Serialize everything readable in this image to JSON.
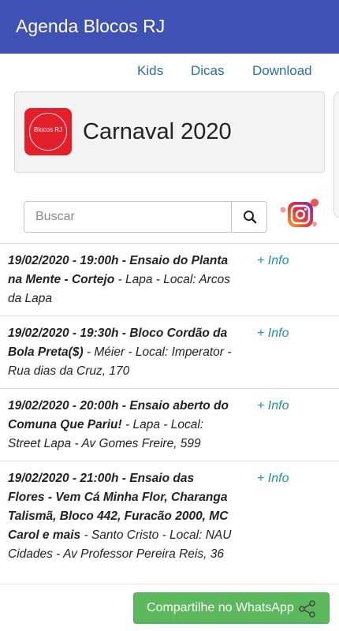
{
  "app": {
    "title": "Agenda Blocos RJ"
  },
  "nav": {
    "kids": "Kids",
    "dicas": "Dicas",
    "download": "Download"
  },
  "banner": {
    "logo_text": "Blocos RJ",
    "title": "Carnaval 2020",
    "logo_color": "#e21f2b"
  },
  "search": {
    "placeholder": "Buscar",
    "icon": "search-icon"
  },
  "instagram": {
    "icon": "instagram-icon"
  },
  "events": [
    {
      "title": "19/02/2020 - 19:00h - Ensaio do Planta na Mente - Cortejo",
      "details": " - Lapa - Local: Arcos da Lapa",
      "info": "+ Info"
    },
    {
      "title": "19/02/2020 - 19:30h - Bloco Cordão da Bola Preta($)",
      "details": " - Méier - Local: Imperator - Rua dias da Cruz, 170",
      "info": "+ Info"
    },
    {
      "title": "19/02/2020 - 20:00h - Ensaio aberto do Comuna Que Pariu!",
      "details": " - Lapa - Local: Street Lapa - Av Gomes Freire, 599",
      "info": "+ Info"
    },
    {
      "title": "19/02/2020 - 21:00h - Ensaio das Flores - Vem Cá Minha Flor, Charanga Talismã, Bloco 442, Furacão 2000, MC Carol e mais",
      "details": " - Santo Cristo - Local: NAU Cidades - Av Professor Pereira Reis, 36",
      "info": "+ Info"
    }
  ],
  "footer": {
    "share_label": "Compartilhe no WhatsApp",
    "share_icon": "share-icon"
  },
  "colors": {
    "appbar": "#3f51b5",
    "link": "#2a6f9f",
    "info": "#1f8fa3",
    "whatsapp_button": "#5cb85c"
  }
}
